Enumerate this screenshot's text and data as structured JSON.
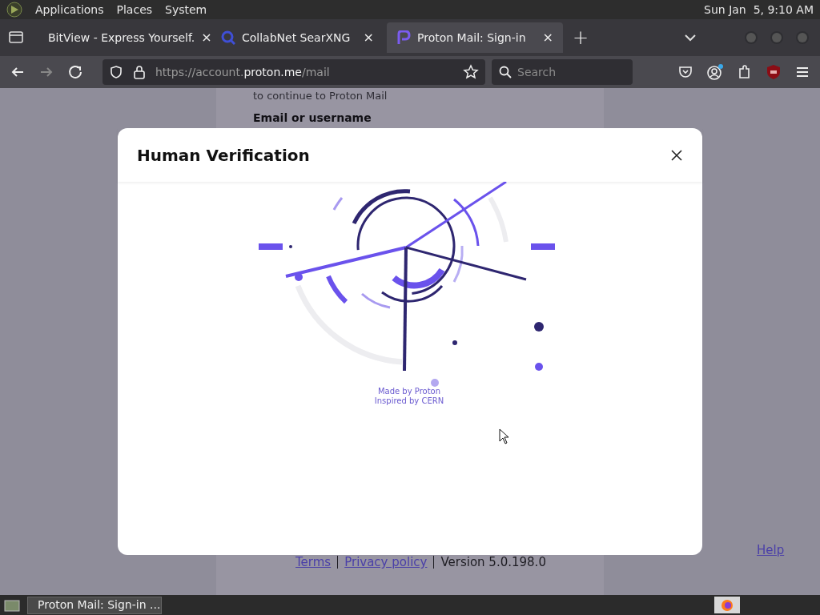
{
  "top_panel": {
    "menus": [
      "Applications",
      "Places",
      "System"
    ],
    "clock": "Sun Jan  5, 9:10 AM"
  },
  "tabs": [
    {
      "title": "BitView - Express Yourself.",
      "selected": false,
      "close": "×"
    },
    {
      "title": "CollabNet SearXNG",
      "selected": false,
      "close": "×"
    },
    {
      "title": "Proton Mail: Sign-in",
      "selected": true,
      "close": "×"
    }
  ],
  "new_tab": "+",
  "address_bar": {
    "prefix": "https://account.",
    "domain": "proton.me",
    "path": "/mail"
  },
  "search_field": {
    "placeholder": "Search"
  },
  "page": {
    "subtitle": "to continue to Proton Mail",
    "field_label": "Email or username",
    "footer_links": [
      "Terms",
      "Privacy policy"
    ],
    "version": "Version 5.0.198.0",
    "help": "Help"
  },
  "dialog": {
    "title": "Human Verification",
    "credits": [
      "Made by Proton",
      "Inspired by CERN"
    ]
  },
  "taskbar": {
    "window": "Proton Mail: Sign-in ..."
  }
}
